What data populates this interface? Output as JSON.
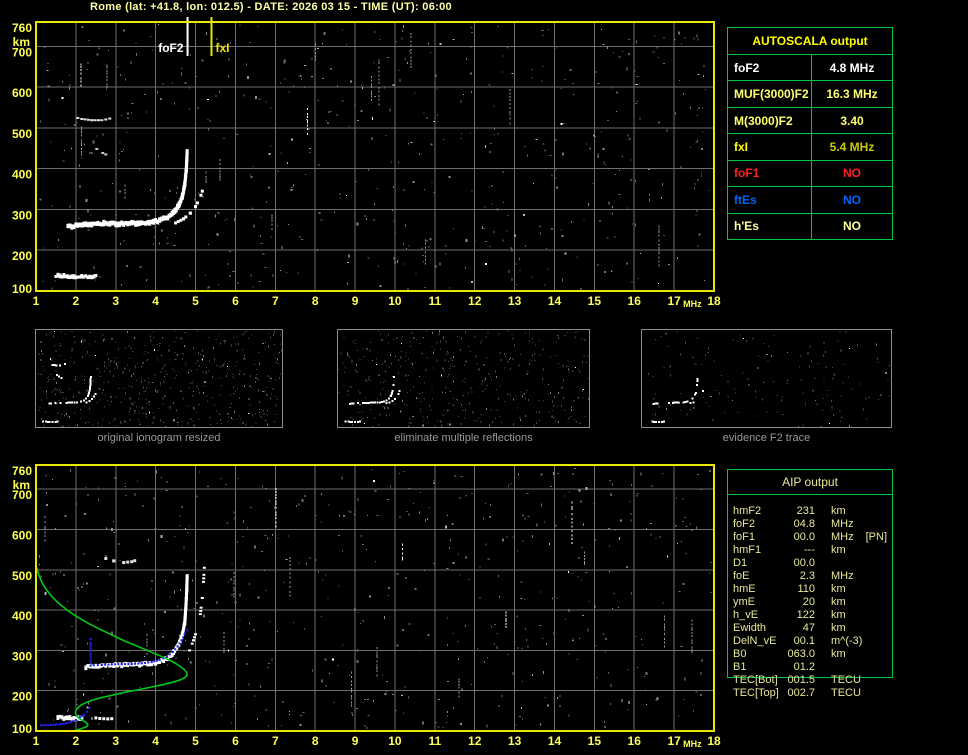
{
  "title": "Rome (lat: +41.8, lon: 012.5) - DATE: 2026 03 15 - TIME (UT): 06:00",
  "colors": {
    "background": "#000000",
    "plot_border": "#e8e800",
    "grid": "#6e6e6e",
    "tick_label": "#ffff55",
    "title": "#ffffa6",
    "table_border": "#00c83c",
    "table_header": "#ffff00",
    "aip_text": "#e8e89a",
    "caption_gray": "#9a9a9a",
    "trace_white": "#ffffff",
    "trace_blue": "#2222ee",
    "profile_green": "#00c818"
  },
  "autoscala": {
    "header": "AUTOSCALA output",
    "rows": [
      {
        "label": "foF2",
        "value": "4.8 MHz",
        "color": "#ffffff"
      },
      {
        "label": "MUF(3000)F2",
        "value": "16.3 MHz",
        "color": "#ffff70"
      },
      {
        "label": "M(3000)F2",
        "value": "3.40",
        "color": "#ffff70"
      },
      {
        "label": "fxI",
        "value": "5.4 MHz",
        "color": "#ffff00",
        "value_color": "#c9c900"
      },
      {
        "label": "foF1",
        "value": "NO",
        "color": "#ff2020"
      },
      {
        "label": "ftEs",
        "value": "NO",
        "color": "#0064ff"
      },
      {
        "label": "h'Es",
        "value": "NO",
        "color": "#ffff99"
      }
    ]
  },
  "thumbnails": [
    {
      "caption": "original ionogram resized"
    },
    {
      "caption": "eliminate multiple reflections"
    },
    {
      "caption": "evidence F2 trace"
    }
  ],
  "aip": {
    "header": "AIP output",
    "rows": [
      {
        "label": "hmF2",
        "value": "231",
        "unit": "km",
        "note": ""
      },
      {
        "label": "foF2",
        "value": "04.8",
        "unit": "MHz",
        "note": ""
      },
      {
        "label": "foF1",
        "value": "00.0",
        "unit": "MHz",
        "note": "[PN]"
      },
      {
        "label": "hmF1",
        "value": "---",
        "unit": "km",
        "note": ""
      },
      {
        "label": "D1",
        "value": "00.0",
        "unit": "",
        "note": ""
      },
      {
        "label": "foE",
        "value": "2.3",
        "unit": "MHz",
        "note": ""
      },
      {
        "label": "hmE",
        "value": "110",
        "unit": "km",
        "note": ""
      },
      {
        "label": "ymE",
        "value": "20",
        "unit": "km",
        "note": ""
      },
      {
        "label": "h_vE",
        "value": "122",
        "unit": "km",
        "note": ""
      },
      {
        "label": "Ewidth",
        "value": "47",
        "unit": "km",
        "note": ""
      },
      {
        "label": "DelN_vE",
        "value": "00.1",
        "unit": "m^(-3)",
        "note": ""
      },
      {
        "label": "B0",
        "value": "063.0",
        "unit": "km",
        "note": ""
      },
      {
        "label": "B1",
        "value": "01.2",
        "unit": "",
        "note": ""
      },
      {
        "label": "TEC[Bot]",
        "value": "001.5",
        "unit": "TECU",
        "note": ""
      },
      {
        "label": "TEC[Top]",
        "value": "002.7",
        "unit": "TECU",
        "note": ""
      }
    ]
  },
  "chart_data": [
    {
      "type": "scatter",
      "title": "ionogram with autoscaled characteristics",
      "xlabel": "MHz",
      "ylabel": "km",
      "xlim": [
        1,
        18
      ],
      "ylim": [
        100,
        760
      ],
      "xticks": [
        1,
        2,
        3,
        4,
        5,
        6,
        7,
        8,
        9,
        10,
        11,
        12,
        13,
        14,
        15,
        16,
        17,
        18
      ],
      "yticks": [
        760,
        700,
        600,
        500,
        400,
        300,
        200,
        100
      ],
      "xunit": "MHz",
      "yunit": "km",
      "markers": [
        {
          "label": "foF2",
          "x": 4.8,
          "color": "#ffffff"
        },
        {
          "label": "fxI",
          "x": 5.4,
          "color": "#e8e800"
        }
      ],
      "series": [
        {
          "name": "es-trace",
          "style": "band",
          "width": 4,
          "color": "#ffffff",
          "points": [
            [
              1.5,
              138
            ],
            [
              1.7,
              136
            ],
            [
              1.95,
              135
            ],
            [
              2.15,
              134
            ],
            [
              2.35,
              135
            ],
            [
              2.5,
              137
            ]
          ]
        },
        {
          "name": "f-trace",
          "style": "band",
          "width": 5,
          "color": "#ffffff",
          "points": [
            [
              1.8,
              258
            ],
            [
              2.05,
              261
            ],
            [
              2.35,
              263
            ],
            [
              2.7,
              265
            ],
            [
              3.1,
              265
            ],
            [
              3.5,
              266
            ],
            [
              3.85,
              268
            ],
            [
              4.1,
              273
            ],
            [
              4.3,
              281
            ],
            [
              4.45,
              293
            ],
            [
              4.58,
              310
            ],
            [
              4.67,
              332
            ],
            [
              4.73,
              360
            ],
            [
              4.77,
              400
            ],
            [
              4.79,
              440
            ]
          ]
        },
        {
          "name": "x-rise",
          "style": "dash",
          "width": 3,
          "color": "#ffffff",
          "points": [
            [
              4.3,
              262
            ],
            [
              4.5,
              267
            ],
            [
              4.7,
              277
            ],
            [
              4.87,
              291
            ],
            [
              5.0,
              307
            ],
            [
              5.1,
              325
            ],
            [
              5.17,
              345
            ]
          ]
        },
        {
          "name": "multiple-echo",
          "style": "dash",
          "width": 2,
          "color": "#dddddd",
          "points": [
            [
              1.95,
              527
            ],
            [
              2.15,
              522
            ],
            [
              2.4,
              519
            ],
            [
              2.65,
              519
            ],
            [
              2.85,
              523
            ],
            [
              3.0,
              530
            ]
          ]
        },
        {
          "name": "scatter-dots",
          "style": "dash",
          "width": 2,
          "color": "#cccccc",
          "points": [
            [
              2.45,
              455
            ],
            [
              2.6,
              442
            ],
            [
              2.75,
              435
            ]
          ]
        }
      ]
    },
    {
      "type": "scatter",
      "title": "ionogram with restored trace and electron density profile",
      "xlabel": "MHz",
      "ylabel": "km",
      "xlim": [
        1,
        18
      ],
      "ylim": [
        100,
        760
      ],
      "xticks": [
        1,
        2,
        3,
        4,
        5,
        6,
        7,
        8,
        9,
        10,
        11,
        12,
        13,
        14,
        15,
        16,
        17,
        18
      ],
      "yticks": [
        760,
        700,
        600,
        500,
        400,
        300,
        200,
        100
      ],
      "xunit": "MHz",
      "yunit": "km",
      "markers": [],
      "series": [
        {
          "name": "es-trace",
          "style": "band",
          "width": 4,
          "color": "#ffffff",
          "points": [
            [
              1.55,
              134
            ],
            [
              1.75,
              132
            ],
            [
              1.95,
              131
            ],
            [
              2.15,
              131
            ]
          ]
        },
        {
          "name": "es-trace-2",
          "style": "dash",
          "width": 3,
          "color": "#ffffff",
          "points": [
            [
              2.4,
              134
            ],
            [
              2.6,
              131
            ],
            [
              2.8,
              130
            ],
            [
              3.0,
              131
            ]
          ]
        },
        {
          "name": "f-left-dash",
          "style": "dash",
          "width": 2,
          "color": "#eeeeee",
          "points": [
            [
              1.6,
              267
            ],
            [
              1.8,
              266
            ],
            [
              2.0,
              264
            ]
          ]
        },
        {
          "name": "f-trace",
          "style": "band",
          "width": 4,
          "color": "#ffffff",
          "points": [
            [
              2.25,
              259
            ],
            [
              2.5,
              261
            ],
            [
              2.85,
              263
            ],
            [
              3.2,
              264
            ],
            [
              3.55,
              265
            ],
            [
              3.85,
              267
            ],
            [
              4.1,
              272
            ],
            [
              4.3,
              281
            ],
            [
              4.45,
              295
            ],
            [
              4.58,
              315
            ],
            [
              4.67,
              340
            ],
            [
              4.73,
              370
            ],
            [
              4.76,
              410
            ],
            [
              4.78,
              450
            ],
            [
              4.79,
              485
            ]
          ]
        },
        {
          "name": "x-rise",
          "style": "dash",
          "width": 2,
          "color": "#ffffff",
          "points": [
            [
              4.85,
              300
            ],
            [
              4.95,
              325
            ],
            [
              5.05,
              355
            ],
            [
              5.12,
              390
            ],
            [
              5.17,
              430
            ],
            [
              5.2,
              470
            ],
            [
              5.22,
              505
            ]
          ]
        },
        {
          "name": "multiple-echo",
          "style": "dash",
          "width": 3,
          "color": "#dddddd",
          "points": [
            [
              2.75,
              528
            ],
            [
              2.95,
              522
            ],
            [
              3.2,
              518
            ],
            [
              3.4,
              520
            ],
            [
              3.55,
              525
            ]
          ]
        },
        {
          "name": "restored-trace-e",
          "style": "dots",
          "width": 2,
          "color": "#2222ee",
          "points": [
            [
              1.0,
              114
            ],
            [
              1.12,
              114
            ],
            [
              1.25,
              115
            ],
            [
              1.38,
              115
            ],
            [
              1.5,
              116
            ],
            [
              1.63,
              117
            ],
            [
              1.75,
              119
            ],
            [
              1.88,
              122
            ],
            [
              2.0,
              127
            ],
            [
              2.1,
              133
            ],
            [
              2.2,
              140
            ],
            [
              2.28,
              148
            ],
            [
              2.34,
              157
            ]
          ]
        },
        {
          "name": "restored-trace-valley",
          "style": "dots",
          "width": 2,
          "color": "#2222ee",
          "points": [
            [
              2.37,
              262
            ],
            [
              2.37,
              275
            ],
            [
              2.37,
              290
            ],
            [
              2.37,
              305
            ],
            [
              2.37,
              318
            ],
            [
              2.37,
              328
            ]
          ]
        },
        {
          "name": "restored-trace-f",
          "style": "dots",
          "width": 2,
          "color": "#2222ee",
          "points": [
            [
              2.45,
              263
            ],
            [
              2.65,
              264
            ],
            [
              2.9,
              265
            ],
            [
              3.15,
              266
            ],
            [
              3.4,
              266
            ],
            [
              3.65,
              268
            ],
            [
              3.9,
              271
            ],
            [
              4.1,
              276
            ],
            [
              4.28,
              284
            ],
            [
              4.43,
              296
            ],
            [
              4.55,
              310
            ],
            [
              4.65,
              325
            ],
            [
              4.73,
              340
            ],
            [
              4.79,
              350
            ]
          ]
        },
        {
          "name": "electron-density-profile",
          "style": "line",
          "width": 1.6,
          "color": "#00c818",
          "points": [
            [
              1.02,
              505
            ],
            [
              1.07,
              487
            ],
            [
              1.15,
              468
            ],
            [
              1.27,
              449
            ],
            [
              1.42,
              431
            ],
            [
              1.6,
              414
            ],
            [
              1.82,
              397
            ],
            [
              2.07,
              381
            ],
            [
              2.35,
              365
            ],
            [
              2.65,
              350
            ],
            [
              2.95,
              336
            ],
            [
              3.25,
              322
            ],
            [
              3.55,
              310
            ],
            [
              3.83,
              298
            ],
            [
              4.08,
              288
            ],
            [
              4.3,
              278
            ],
            [
              4.48,
              269
            ],
            [
              4.62,
              260
            ],
            [
              4.72,
              252
            ],
            [
              4.78,
              245
            ],
            [
              4.79,
              240
            ],
            [
              4.74,
              233
            ],
            [
              4.62,
              227
            ],
            [
              4.43,
              221
            ],
            [
              4.18,
              215
            ],
            [
              3.88,
              209
            ],
            [
              3.55,
              202
            ],
            [
              3.22,
              196
            ],
            [
              2.92,
              189
            ],
            [
              2.65,
              183
            ],
            [
              2.43,
              177
            ],
            [
              2.26,
              171
            ],
            [
              2.14,
              165
            ],
            [
              2.06,
              159
            ],
            [
              2.01,
              153
            ],
            [
              1.99,
              147
            ],
            [
              2.0,
              141
            ],
            [
              2.03,
              136
            ],
            [
              2.08,
              131
            ],
            [
              2.15,
              127
            ],
            [
              2.22,
              123
            ],
            [
              2.28,
              119
            ],
            [
              2.3,
              115
            ],
            [
              2.27,
              111
            ],
            [
              2.2,
              108
            ],
            [
              2.11,
              105
            ],
            [
              2.03,
              103
            ],
            [
              1.99,
              101
            ]
          ]
        }
      ]
    }
  ]
}
